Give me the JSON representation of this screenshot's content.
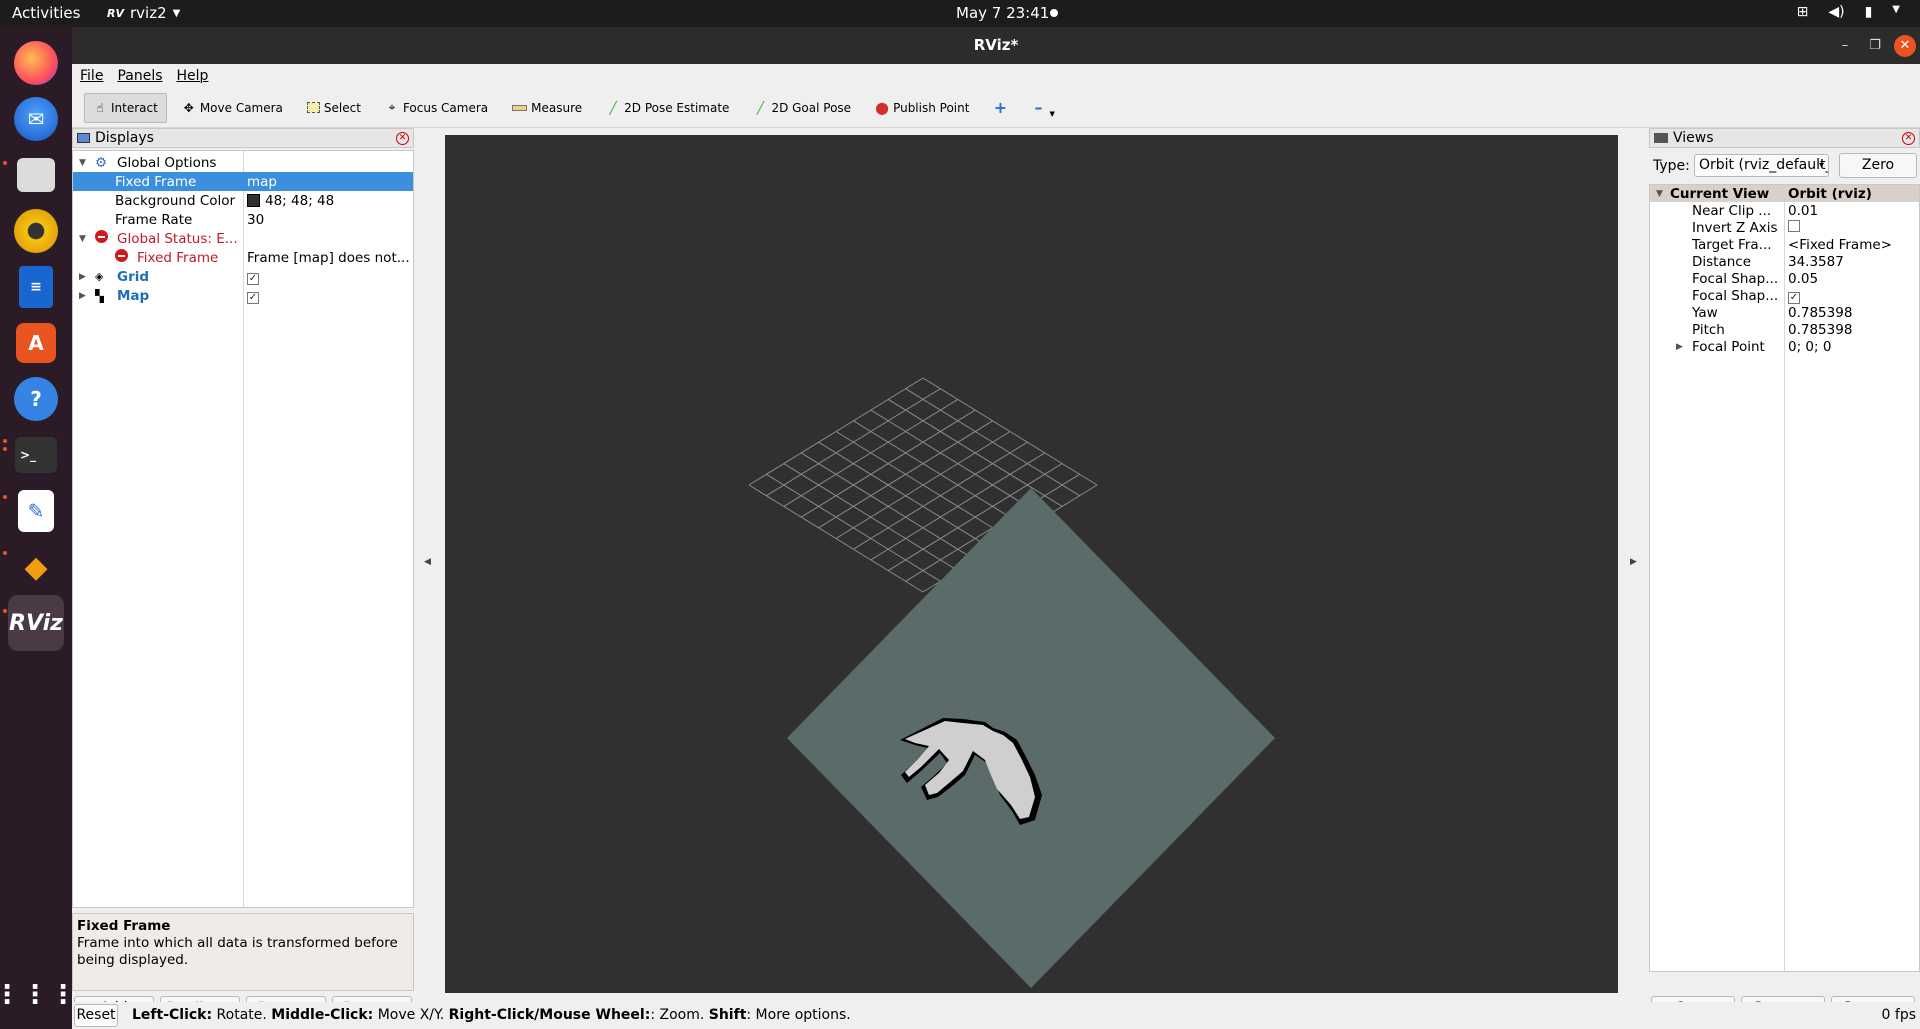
{
  "topbar": {
    "activities": "Activities",
    "app_name": "rviz2",
    "clock": "May 7  23:41"
  },
  "dock": {
    "items": [
      "firefox-icon",
      "thunderbird-icon",
      "files-icon",
      "rhythmbox-icon",
      "writer-icon",
      "software-icon",
      "help-icon",
      "terminal-icon",
      "text-editor-icon",
      "layers-icon",
      "rviz-icon",
      "apps-grid-icon"
    ]
  },
  "window": {
    "title": "RViz*"
  },
  "menu": {
    "file": "File",
    "panels": "Panels",
    "help": "Help"
  },
  "toolbar": {
    "interact": "Interact",
    "move_camera": "Move Camera",
    "select": "Select",
    "focus_camera": "Focus Camera",
    "measure": "Measure",
    "pose_estimate": "2D Pose Estimate",
    "goal_pose": "2D Goal Pose",
    "publish_point": "Publish Point"
  },
  "displays": {
    "title": "Displays",
    "global_options": "Global Options",
    "fixed_frame_label": "Fixed Frame",
    "fixed_frame_value": "map",
    "bg_color_label": "Background Color",
    "bg_color_value": "48; 48; 48",
    "frame_rate_label": "Frame Rate",
    "frame_rate_value": "30",
    "global_status": "Global Status: E...",
    "status_fixed_frame": "Fixed Frame",
    "status_fixed_frame_value": "Frame [map] does not...",
    "grid": "Grid",
    "map": "Map",
    "help_title": "Fixed Frame",
    "help_text": "Frame into which all data is transformed before being displayed.",
    "add": "Add",
    "duplicate": "Duplicate",
    "remove": "Remove",
    "rename": "Rename"
  },
  "views": {
    "title": "Views",
    "type_label": "Type:",
    "type_value": "Orbit (rviz_default_plugins)",
    "zero": "Zero",
    "current_view": "Current View",
    "current_view_value": "Orbit (rviz)",
    "props": [
      {
        "k": "Near Clip ...",
        "v": "0.01"
      },
      {
        "k": "Invert Z Axis",
        "v": ""
      },
      {
        "k": "Target Fra...",
        "v": "<Fixed Frame>"
      },
      {
        "k": "Distance",
        "v": "34.3587"
      },
      {
        "k": "Focal Shap...",
        "v": "0.05"
      },
      {
        "k": "Focal Shap...",
        "v": ""
      },
      {
        "k": "Yaw",
        "v": "0.785398"
      },
      {
        "k": "Pitch",
        "v": "0.785398"
      },
      {
        "k": "Focal Point",
        "v": "0; 0; 0"
      }
    ],
    "save": "Save",
    "remove": "Remove",
    "rename": "Rename"
  },
  "status": {
    "reset": "Reset",
    "left_click": "Left-Click:",
    "left_click_action": " Rotate. ",
    "middle_click": "Middle-Click:",
    "middle_click_action": " Move X/Y. ",
    "right_click": "Right-Click/Mouse Wheel:",
    "right_click_action": ": Zoom. ",
    "shift": "Shift",
    "shift_action": ": More options.",
    "fps": "0 fps"
  },
  "colors": {
    "viewport_bg": "#303030",
    "map_plane": "#5b6b69",
    "selection": "#3c8fde",
    "error": "#c01c28",
    "accent": "#e95420"
  }
}
